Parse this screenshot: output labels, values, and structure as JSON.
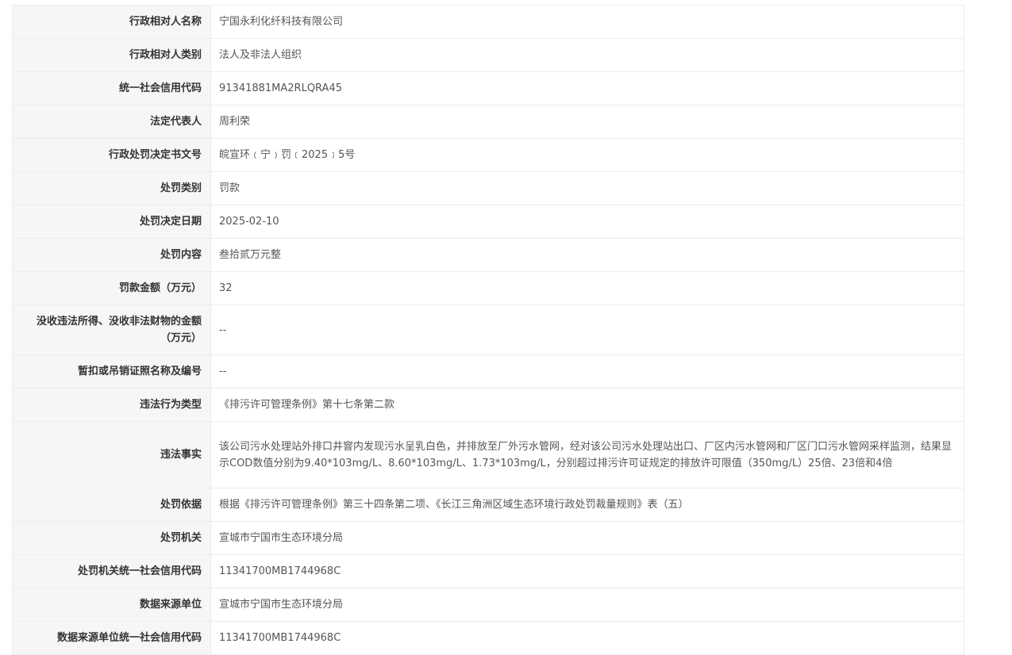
{
  "rows": [
    {
      "label": "行政相对人名称",
      "value": "宁国永利化纤科技有限公司"
    },
    {
      "label": "行政相对人类别",
      "value": "法人及非法人组织"
    },
    {
      "label": "统一社会信用代码",
      "value": "91341881MA2RLQRA45"
    },
    {
      "label": "法定代表人",
      "value": "周利荣"
    },
    {
      "label": "行政处罚决定书文号",
      "value": "皖宣环﹙宁﹚罚﹝2025﹞5号"
    },
    {
      "label": "处罚类别",
      "value": "罚款"
    },
    {
      "label": "处罚决定日期",
      "value": "2025-02-10"
    },
    {
      "label": "处罚内容",
      "value": "叁拾贰万元整"
    },
    {
      "label": "罚款金额（万元）",
      "value": "32"
    },
    {
      "label": "没收违法所得、没收非法财物的金额（万元）",
      "value": "--"
    },
    {
      "label": "暂扣或吊销证照名称及编号",
      "value": "--"
    },
    {
      "label": "违法行为类型",
      "value": "《排污许可管理条例》第十七条第二款"
    },
    {
      "label": "违法事实",
      "value": "该公司污水处理站外排口井窨内发现污水呈乳白色，并排放至厂外污水管网，经对该公司污水处理站出口、厂区内污水管网和厂区门口污水管网采样监测，结果显示COD数值分别为9.40*103mg/L、8.60*103mg/L、1.73*103mg/L，分别超过排污许可证规定的排放许可限值（350mg/L）25倍、23倍和4倍"
    },
    {
      "label": "处罚依据",
      "value": "根据《排污许可管理条例》第三十四条第二项、《长江三角洲区域生态环境行政处罚裁量规则》表（五）"
    },
    {
      "label": "处罚机关",
      "value": "宣城市宁国市生态环境分局"
    },
    {
      "label": "处罚机关统一社会信用代码",
      "value": "11341700MB1744968C"
    },
    {
      "label": "数据来源单位",
      "value": "宣城市宁国市生态环境分局"
    },
    {
      "label": "数据来源单位统一社会信用代码",
      "value": "11341700MB1744968C"
    }
  ]
}
